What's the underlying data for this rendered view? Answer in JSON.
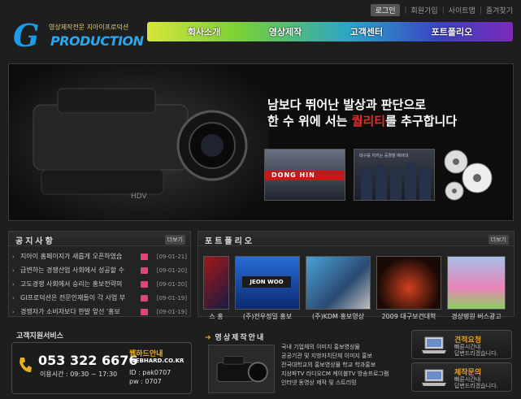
{
  "top_links": {
    "login": "로그인",
    "join": "회원가입",
    "sitemap": "사이트맵",
    "favorite": "즐겨찾기"
  },
  "logo": {
    "tagline": "영상제작전문 지아이프로덕션",
    "word": "PRODUCTION",
    "letter": "G"
  },
  "nav": [
    {
      "label": "회사소개"
    },
    {
      "label": "영상제작"
    },
    {
      "label": "고객센터"
    },
    {
      "label": "포트폴리오"
    }
  ],
  "hero": {
    "line1": "남보다 뛰어난 발상과 판단으로",
    "line2_pre": "한 수 위에 서는 ",
    "line2_emph": "퀄리티",
    "line2_post": "를 추구합니다",
    "thumb1_text": "DONG HIN",
    "thumb2_caption": "대구를 지키는 공경찰 예비대"
  },
  "notice": {
    "title": "공지사항",
    "more": "더보기",
    "items": [
      {
        "title": "지아이 홈페이지가 새롭게 오픈하였습",
        "date": "[09-01-21]"
      },
      {
        "title": "급변하는 경쟁산업 사회에서 성공할 수",
        "date": "[09-01-20]"
      },
      {
        "title": "고도경쟁 사회에서 승리는 홍보전략의",
        "date": "[09-01-20]"
      },
      {
        "title": "GI프로덕션은 전문인재들이 각 사업 부",
        "date": "[09-01-19]"
      },
      {
        "title": "경쟁자가 소비자보다 한발 앞선 '홍보",
        "date": "[09-01-19]"
      }
    ]
  },
  "portfolio": {
    "title": "포트폴리오",
    "more": "더보기",
    "items": [
      {
        "label": "스 홍"
      },
      {
        "label": "(주)전우정밀 홍보"
      },
      {
        "label": "(주)KDM 홍보영상"
      },
      {
        "label": "2009 대구보건대학"
      },
      {
        "label": "경상병원 버스광고"
      }
    ]
  },
  "customer": {
    "title": "고객지원서비스",
    "phone": "053 322 6676",
    "hours": "이용시간 : 09:30 ~ 17:30",
    "webhard_title": "웹하드안내",
    "webhard_url": "WEBHARD.CO.KR",
    "id": "ID    : pak0707",
    "pw": "pw  : 0707"
  },
  "guide": {
    "title": "영상제작안내",
    "lines": [
      "국내 기업체의 이미지 홍보영상물",
      "공공기관 및 지방자치단체 이미지 홍보",
      "전국대학교의 홍보영상물 학교 학과홍보",
      "지상파TV 라디오CM 케이블TV 방송프로그램",
      "인터넷 동영상 제작 및 스트리밍"
    ]
  },
  "side_buttons": [
    {
      "t1": "견적요청",
      "t2a": "빠른시간내",
      "t2b": "답변드리겠습니다."
    },
    {
      "t1": "제작문의",
      "t2a": "빠른시간내",
      "t2b": "답변드리겠습니다."
    }
  ],
  "colors": {
    "accent_red": "#e82b2b",
    "accent_orange": "#e9a31d",
    "logo_blue": "#1e9be6"
  }
}
